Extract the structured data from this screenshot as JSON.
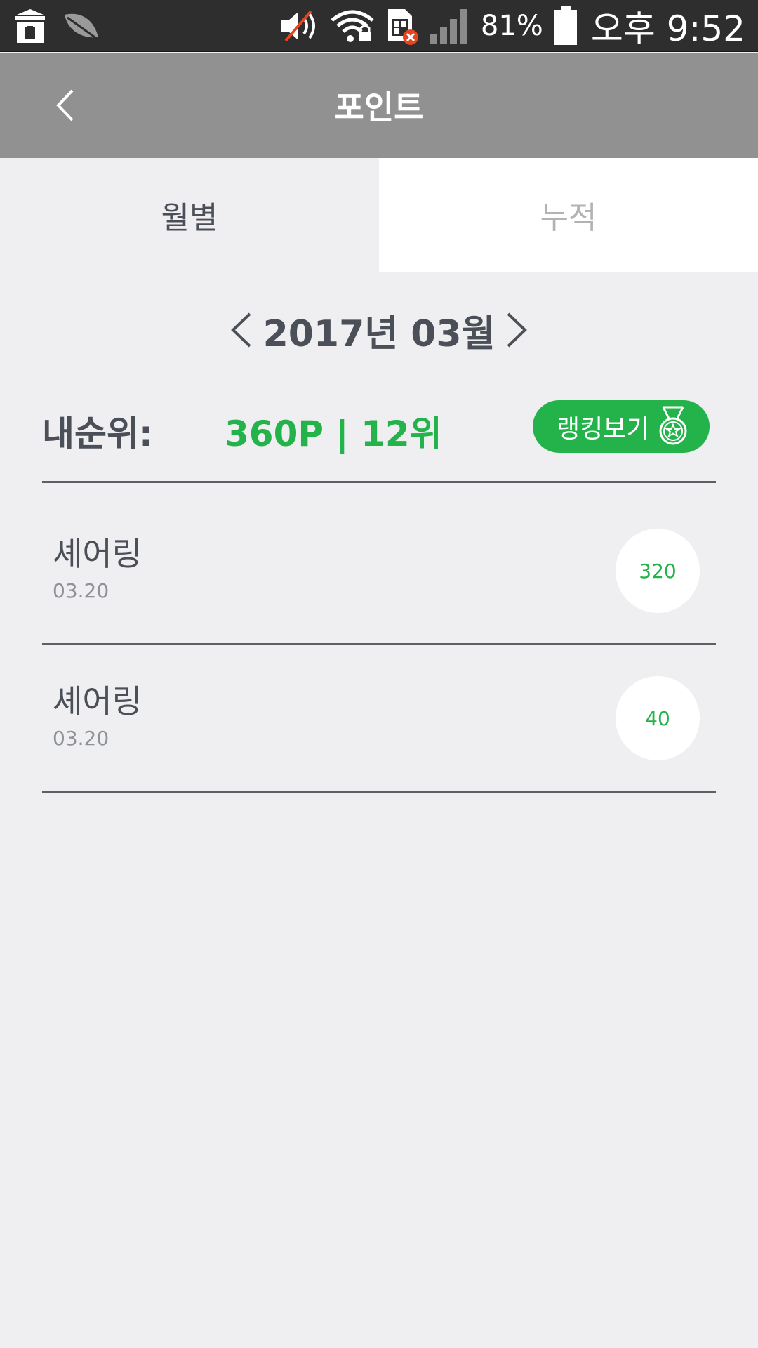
{
  "status_bar": {
    "battery_percent": "81%",
    "time": "오후 9:52",
    "icons": [
      "store-icon",
      "leaf-icon",
      "mute-icon",
      "wifi-lock-icon",
      "sim-error-icon",
      "signal-icon",
      "battery-icon"
    ]
  },
  "app_bar": {
    "title": "포인트",
    "back_icon": "chevron-left-icon"
  },
  "tabs": [
    {
      "label": "월별",
      "selected": true
    },
    {
      "label": "누적",
      "selected": false
    }
  ],
  "month_nav": {
    "label": "2017년 03월"
  },
  "rank": {
    "label": "내순위:",
    "value": "360P | 12위",
    "button_label": "랭킹보기",
    "button_icon": "medal-icon"
  },
  "items": [
    {
      "title": "셰어링",
      "date": "03.20",
      "points": "320"
    },
    {
      "title": "셰어링",
      "date": "03.20",
      "points": "40"
    }
  ],
  "colors": {
    "accent": "#24b34b",
    "app_bar": "#919191",
    "background": "#efeef1",
    "text_dark": "#4b4f58"
  }
}
